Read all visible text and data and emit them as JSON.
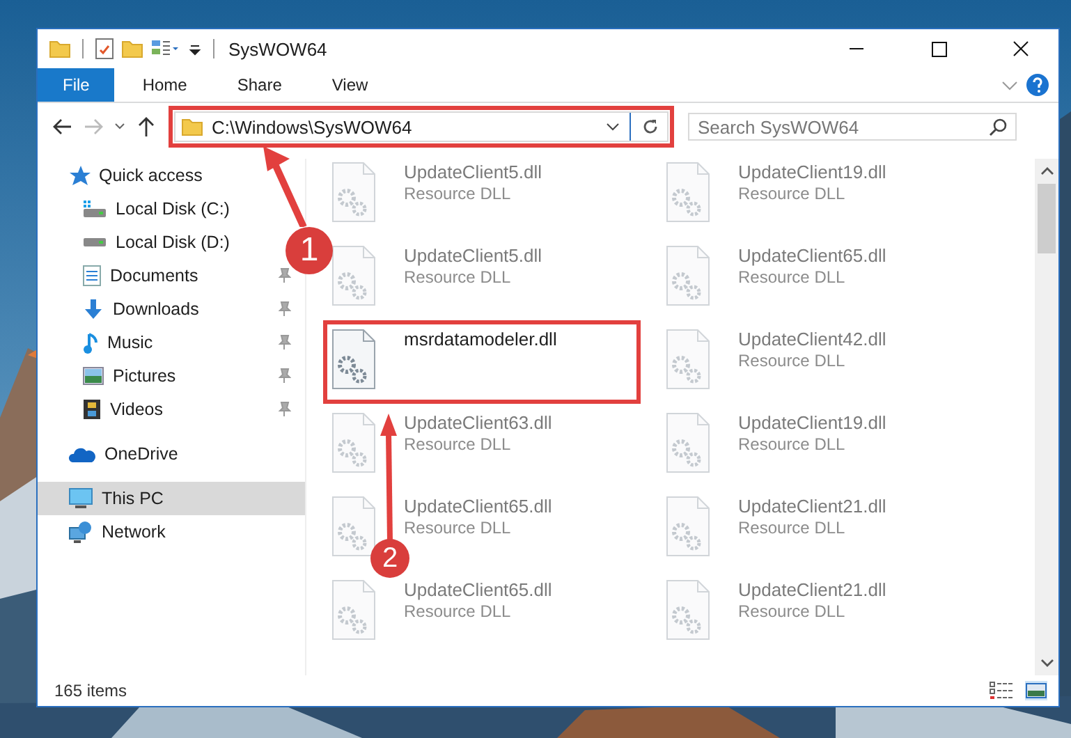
{
  "window": {
    "title": "SysWOW64"
  },
  "ribbon_tabs": [
    {
      "label": "File",
      "selected": true
    },
    {
      "label": "Home",
      "selected": false
    },
    {
      "label": "Share",
      "selected": false
    },
    {
      "label": "View",
      "selected": false
    }
  ],
  "address": {
    "path": "C:\\Windows\\SysWOW64",
    "highlighted": true
  },
  "search": {
    "placeholder": "Search SysWOW64"
  },
  "navigation": [
    {
      "label": "Quick access",
      "selected": false,
      "children": [
        {
          "label": "Local Disk (C:)",
          "pinned": false
        },
        {
          "label": "Local Disk (D:)",
          "pinned": false
        },
        {
          "label": "Documents",
          "pinned": true
        },
        {
          "label": "Downloads",
          "pinned": true
        },
        {
          "label": "Music",
          "pinned": true
        },
        {
          "label": "Pictures",
          "pinned": true
        },
        {
          "label": "Videos",
          "pinned": true
        }
      ]
    },
    {
      "label": "OneDrive",
      "selected": false
    },
    {
      "label": "This PC",
      "selected": true
    },
    {
      "label": "Network",
      "selected": false
    }
  ],
  "files": [
    {
      "name": "UpdateClient5.dll",
      "type": "Resource DLL",
      "dimmed": true,
      "highlighted": false
    },
    {
      "name": "UpdateClient19.dll",
      "type": "Resource DLL",
      "dimmed": true,
      "highlighted": false
    },
    {
      "name": "UpdateClient5.dll",
      "type": "Resource DLL",
      "dimmed": true,
      "highlighted": false
    },
    {
      "name": "UpdateClient65.dll",
      "type": "Resource DLL",
      "dimmed": true,
      "highlighted": false
    },
    {
      "name": "msrdatamodeler.dll",
      "dimmed": false,
      "highlighted": true
    },
    {
      "name": "UpdateClient42.dll",
      "type": "Resource DLL",
      "dimmed": true,
      "highlighted": false
    },
    {
      "name": "UpdateClient63.dll",
      "type": "Resource DLL",
      "dimmed": true,
      "highlighted": false
    },
    {
      "name": "UpdateClient19.dll",
      "type": "Resource DLL",
      "dimmed": true,
      "highlighted": false
    },
    {
      "name": "UpdateClient65.dll",
      "type": "Resource DLL",
      "dimmed": true,
      "highlighted": false
    },
    {
      "name": "UpdateClient21.dll",
      "type": "Resource DLL",
      "dimmed": true,
      "highlighted": false
    },
    {
      "name": "UpdateClient65.dll",
      "type": "Resource DLL",
      "dimmed": true,
      "highlighted": false
    },
    {
      "name": "UpdateClient21.dll",
      "type": "Resource DLL",
      "dimmed": true,
      "highlighted": false
    }
  ],
  "status_bar": {
    "item_count": "165 items"
  },
  "callouts": [
    {
      "number": "1"
    },
    {
      "number": "2"
    }
  ]
}
